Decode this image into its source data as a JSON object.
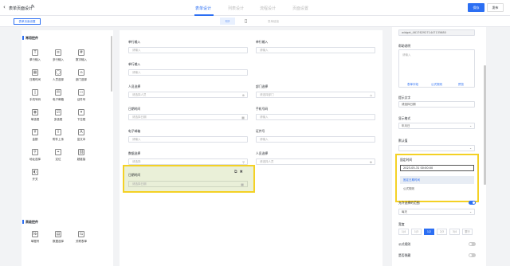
{
  "header": {
    "title": "表单页面设计",
    "tabs": [
      "表单设计",
      "列表设计",
      "流程设计",
      "页面设置"
    ],
    "save": "保存",
    "publish": "发布"
  },
  "toolbar": {
    "page_settings": "表单页面设置",
    "hide_link": "表单链接"
  },
  "left_panel": {
    "section1": "常用控件",
    "items1": [
      [
        "单行输入",
        "T"
      ],
      [
        "多行输入",
        "≡"
      ],
      [
        "数字输入",
        "#"
      ],
      [
        "日期时间",
        "▦"
      ],
      [
        "人员选择",
        "◯"
      ],
      [
        "部门选择",
        "⌂"
      ],
      [
        "手机号码",
        "▯"
      ],
      [
        "电子邮箱",
        "✉"
      ],
      [
        "证件号",
        "▭"
      ],
      [
        "单选框",
        "◉"
      ],
      [
        "多选框",
        "☑"
      ],
      [
        "下拉框",
        "▾"
      ],
      [
        "金额",
        "¥"
      ],
      [
        "附件上传",
        "⇪"
      ],
      [
        "富文本",
        "A"
      ],
      [
        "地址选择",
        "⚲"
      ],
      [
        "定位",
        "⌖"
      ],
      [
        "超链接",
        "⛓"
      ],
      [
        "开关",
        "◐"
      ]
    ],
    "section2": "高级控件",
    "items2": [
      [
        "单据号",
        "№"
      ],
      [
        "数据选择",
        "▤"
      ],
      [
        "关联表单",
        "⇆"
      ]
    ]
  },
  "canvas": {
    "fields": [
      {
        "label": "单行输入",
        "ph": "请输入",
        "icon": ""
      },
      {
        "label": "单行输入",
        "ph": "请输入",
        "icon": ""
      },
      {
        "label": "单行输入",
        "ph": "请输入",
        "icon": ""
      },
      {
        "label": "人员选择",
        "ph": "请选择人员",
        "icon": "⊕"
      },
      {
        "label": "部门选择",
        "ph": "请选择部门",
        "icon": "⌂"
      },
      {
        "label": "日期时间",
        "ph": "请选择日期",
        "icon": "▦"
      },
      {
        "label": "手机号码",
        "ph": "请输入",
        "icon": ""
      },
      {
        "label": "电子邮箱",
        "ph": "请输入",
        "icon": ""
      },
      {
        "label": "证件号",
        "ph": "请输入",
        "icon": ""
      },
      {
        "label": "数据选择",
        "ph": "请选择",
        "icon": "⚲"
      },
      {
        "label": "人员选择",
        "ph": "请选择人员",
        "icon": "⊕"
      }
    ],
    "selected": {
      "label": "日期时间",
      "ph": "请选择日期",
      "icon": "▦",
      "tools": "⧉🗑"
    }
  },
  "right_panel": {
    "widget_id": "widget_4617629271447135680",
    "hint_label": "帮助说明",
    "hint_ph": "请输入",
    "links": [
      "表单字段",
      "公式规则",
      "预览"
    ],
    "placeholder_label": "提示文字",
    "placeholder_val": "请选择日期",
    "display_label": "显示格式",
    "display_val": "年月日",
    "default_label": "默认值",
    "default_val": "",
    "dd_label": "固定时间",
    "dd_value": "2023-05-31 00:00:00",
    "dd_opt1": "固定日期时间",
    "dd_opt2": "公式规则",
    "allow_label": "允许选择的范围",
    "allow_val": "每天",
    "width_label": "宽度",
    "width_opts": [
      "1/4",
      "1/3",
      "1/2",
      "2/3",
      "3/4",
      "整行"
    ],
    "formula_label": "公式规则",
    "hidden_label": "是否隐藏"
  }
}
